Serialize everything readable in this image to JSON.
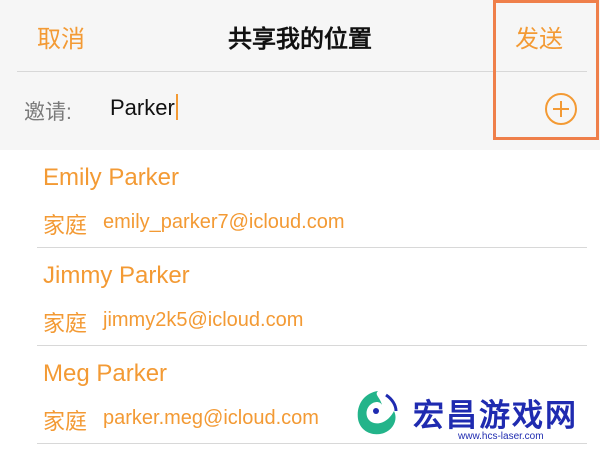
{
  "nav": {
    "cancel_label": "取消",
    "title": "共享我的位置",
    "send_label": "发送"
  },
  "invite": {
    "label": "邀请:",
    "value": "Parker",
    "add_icon": "plus-circle-icon"
  },
  "contacts": [
    {
      "name": "Emily Parker",
      "tag": "家庭",
      "email": "emily_parker7@icloud.com"
    },
    {
      "name": "Jimmy Parker",
      "tag": "家庭",
      "email": "jimmy2k5@icloud.com"
    },
    {
      "name": "Meg Parker",
      "tag": "家庭",
      "email": "parker.meg@icloud.com"
    }
  ],
  "watermark": {
    "brand": "宏昌游戏网",
    "url": "www.hcs-laser.com"
  },
  "colors": {
    "accent": "#f39a34",
    "highlight": "#ef7f4a",
    "watermark": "#1f2bb0"
  }
}
